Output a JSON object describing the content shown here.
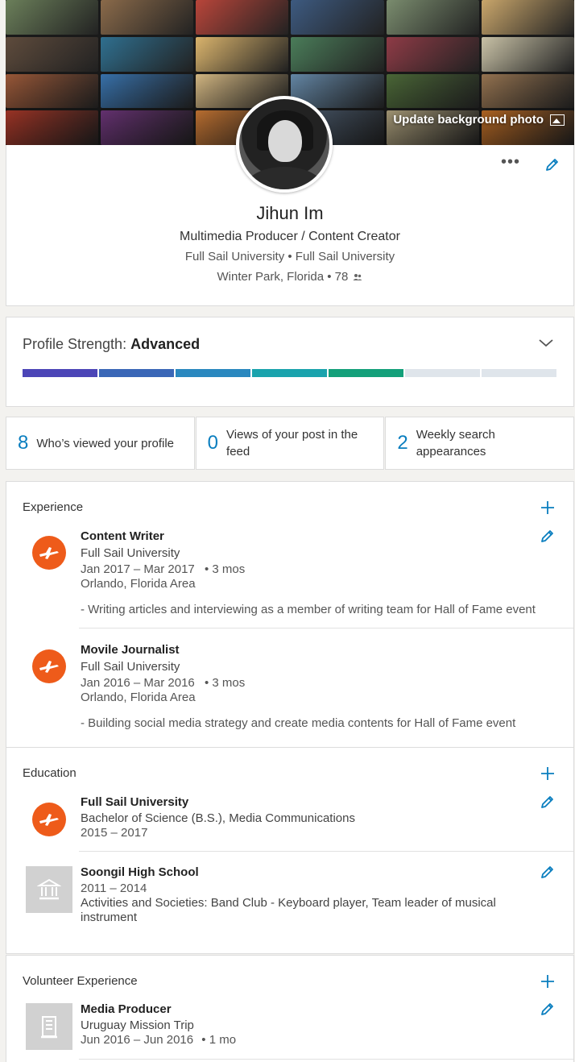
{
  "cover": {
    "update_label": "Update background photo",
    "tile_colors": [
      "#6b7f5a",
      "#8a6a4a",
      "#b8453a",
      "#3d5a80",
      "#7a8c6e",
      "#c9a66b",
      "#5e4b3c",
      "#2f6f8f",
      "#d9b36c",
      "#4a7c59",
      "#8e3b46",
      "#c8c1a6",
      "#a35d3b",
      "#3b78b5",
      "#e0c28a",
      "#6a8fb0",
      "#4f6d3a",
      "#9e7a55",
      "#c2402e",
      "#7d3d8c",
      "#e88a3c",
      "#5b6f87",
      "#c7b88f",
      "#d87b2a"
    ]
  },
  "profile": {
    "name": "Jihun Im",
    "headline": "Multimedia Producer / Content Creator",
    "schools": "Full Sail University • Full Sail University",
    "location": "Winter Park, Florida • 78",
    "more_label": "•••",
    "connections_icon": "people-icon"
  },
  "strength": {
    "label": "Profile Strength:",
    "level": "Advanced",
    "filled_segments": 5,
    "total_segments": 7,
    "segment_colors": [
      "#4c45b7",
      "#3a67b7",
      "#2a88bf",
      "#1aa3ad",
      "#14a07a",
      "#dfe5eb",
      "#dfe5eb"
    ]
  },
  "stats": [
    {
      "value": "8",
      "label": "Who’s viewed your profile"
    },
    {
      "value": "0",
      "label": "Views of your post in the feed"
    },
    {
      "value": "2",
      "label": "Weekly search appearances"
    }
  ],
  "experience": {
    "title": "Experience",
    "items": [
      {
        "title": "Content Writer",
        "org": "Full Sail University",
        "dates": "Jan 2017 – Mar 2017",
        "duration": "• 3 mos",
        "location": "Orlando, Florida Area",
        "description": "- Writing articles and interviewing as a member of writing team for Hall of Fame event"
      },
      {
        "title": "Movile Journalist",
        "org": "Full Sail University",
        "dates": "Jan 2016 – Mar 2016",
        "duration": "• 3 mos",
        "location": "Orlando, Florida Area",
        "description": "- Building social media strategy and create media contents for Hall of Fame event"
      }
    ]
  },
  "education": {
    "title": "Education",
    "items": [
      {
        "school": "Full Sail University",
        "degree": "Bachelor of Science (B.S.), Media Communications",
        "years": "2015 – 2017"
      },
      {
        "school": "Soongil High School",
        "years": "2011 – 2014",
        "activities_line1": "Activities and Societies: Band Club - Keyboard player, Team leader of musical",
        "activities_line2": "instrument"
      }
    ]
  },
  "volunteer": {
    "title": "Volunteer Experience",
    "items": [
      {
        "role": "Media Producer",
        "org": "Uruguay Mission Trip",
        "dates": "Jun 2016 – Jun 2016",
        "duration": "• 1 mo"
      }
    ]
  },
  "colors": {
    "accent": "#0a7ebf",
    "fullsail": "#ee5b1a"
  }
}
